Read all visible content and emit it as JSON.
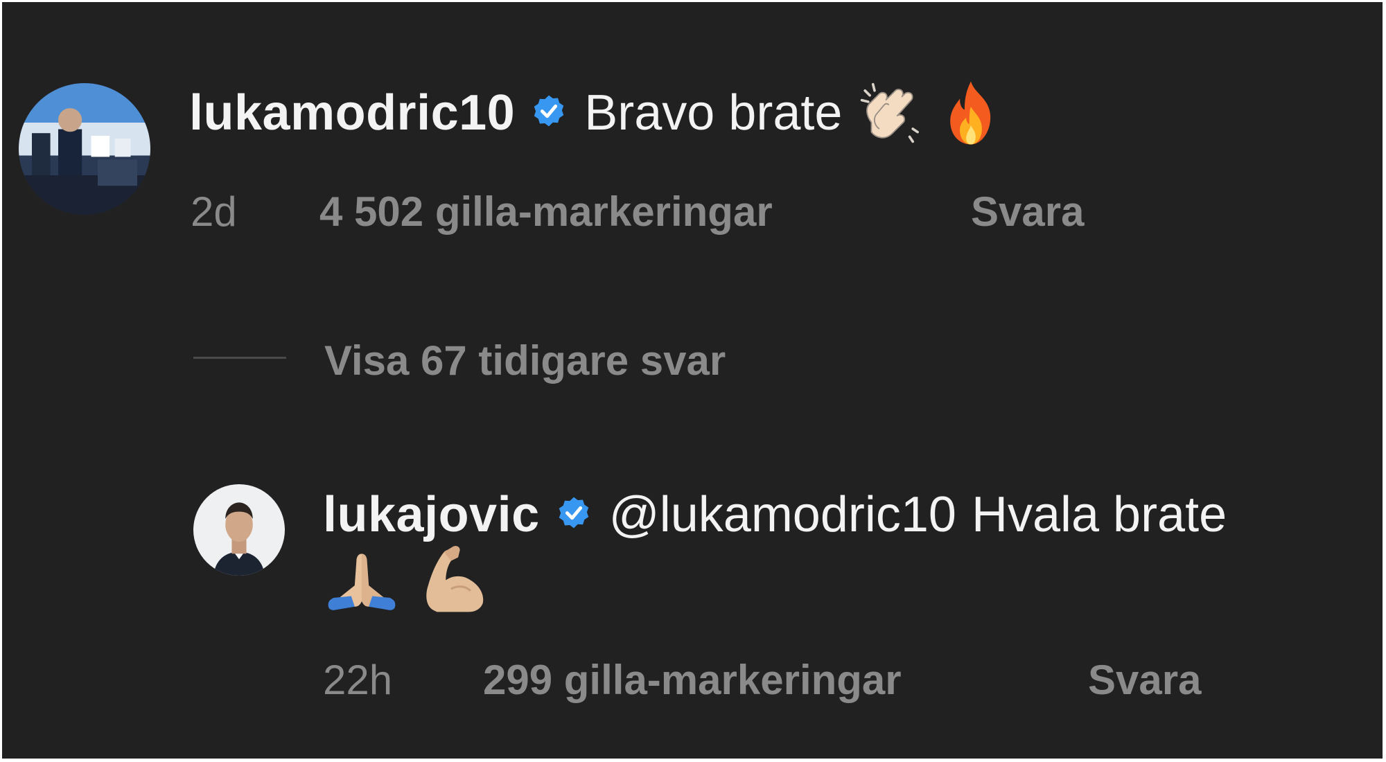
{
  "comments": [
    {
      "username": "lukamodric10",
      "verified": true,
      "text": "Bravo brate",
      "emojis": [
        "clapping-hands-emoji",
        "fire-emoji"
      ],
      "time": "2d",
      "likes": "4 502 gilla-markeringar",
      "reply_label": "Svara"
    }
  ],
  "view_more": "Visa 67 tidigare svar",
  "replies": [
    {
      "username": "lukajovic",
      "verified": true,
      "mention": "@lukamodric10",
      "text": "Hvala brate",
      "emojis": [
        "folded-hands-emoji",
        "flexed-biceps-emoji"
      ],
      "time": "22h",
      "likes": "299 gilla-markeringar",
      "reply_label": "Svara"
    }
  ],
  "colors": {
    "background": "#212122",
    "primary_text": "#f3f3f3",
    "secondary_text": "#8a8a8b",
    "verified_blue": "#3897f0"
  }
}
